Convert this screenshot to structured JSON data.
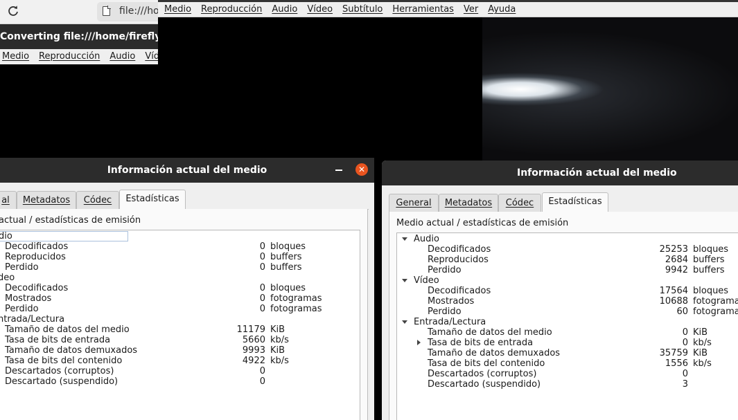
{
  "browser": {
    "url": "file:///ho"
  },
  "converting_window": {
    "title": "Converting file:///home/firefly/M",
    "menu": [
      "Medio",
      "Reproducción",
      "Audio",
      "Víde"
    ]
  },
  "vlc_main": {
    "menu": [
      "Medio",
      "Reproducción",
      "Audio",
      "Vídeo",
      "Subtítulo",
      "Herramientas",
      "Ver",
      "Ayuda"
    ]
  },
  "dialog_left": {
    "title": "Información actual del medio",
    "close_glyph": "✕",
    "tabs": [
      "al",
      "Metadatos",
      "Códec",
      "Estadísticas"
    ],
    "section_label": "actual / estadísticas de emisión",
    "rows": [
      {
        "label": "dio",
        "value": "",
        "unit": "",
        "level": 0
      },
      {
        "label": "Decodificados",
        "value": "0",
        "unit": "bloques",
        "level": 1
      },
      {
        "label": "Reproducidos",
        "value": "0",
        "unit": "buffers",
        "level": 1
      },
      {
        "label": "Perdido",
        "value": "0",
        "unit": "buffers",
        "level": 1
      },
      {
        "label": "deo",
        "value": "",
        "unit": "",
        "level": 0
      },
      {
        "label": "Decodificados",
        "value": "0",
        "unit": "bloques",
        "level": 1
      },
      {
        "label": "Mostrados",
        "value": "0",
        "unit": "fotogramas",
        "level": 1
      },
      {
        "label": "Perdido",
        "value": "0",
        "unit": "fotogramas",
        "level": 1
      },
      {
        "label": "ntrada/Lectura",
        "value": "",
        "unit": "",
        "level": 0
      },
      {
        "label": "Tamaño de datos del medio",
        "value": "11179",
        "unit": "KiB",
        "level": 1
      },
      {
        "label": "Tasa de bits de entrada",
        "value": "5660",
        "unit": "kb/s",
        "level": 1
      },
      {
        "label": "Tamaño de datos demuxados",
        "value": "9993",
        "unit": "KiB",
        "level": 1
      },
      {
        "label": "Tasa de bits del contenido",
        "value": "4922",
        "unit": "kb/s",
        "level": 1
      },
      {
        "label": "Descartados (corruptos)",
        "value": "0",
        "unit": "",
        "level": 1
      },
      {
        "label": "Descartado (suspendido)",
        "value": "0",
        "unit": "",
        "level": 1
      }
    ]
  },
  "dialog_right": {
    "title": "Información actual del medio",
    "tabs": [
      "General",
      "Metadatos",
      "Códec",
      "Estadísticas"
    ],
    "section_label": "Medio actual / estadísticas de emisión",
    "rows": [
      {
        "label": "Audio",
        "value": "",
        "unit": "",
        "level": 0,
        "expander": "down"
      },
      {
        "label": "Decodificados",
        "value": "25253",
        "unit": "bloques",
        "level": 1
      },
      {
        "label": "Reproducidos",
        "value": "2684",
        "unit": "buffers",
        "level": 1
      },
      {
        "label": "Perdido",
        "value": "9942",
        "unit": "buffers",
        "level": 1
      },
      {
        "label": "Vídeo",
        "value": "",
        "unit": "",
        "level": 0,
        "expander": "down"
      },
      {
        "label": "Decodificados",
        "value": "17564",
        "unit": "bloques",
        "level": 1
      },
      {
        "label": "Mostrados",
        "value": "10688",
        "unit": "fotogramas",
        "level": 1
      },
      {
        "label": "Perdido",
        "value": "60",
        "unit": "fotogramas",
        "level": 1
      },
      {
        "label": "Entrada/Lectura",
        "value": "",
        "unit": "",
        "level": 0,
        "expander": "down"
      },
      {
        "label": "Tamaño de datos del medio",
        "value": "0",
        "unit": "KiB",
        "level": 1
      },
      {
        "label": "Tasa de bits de entrada",
        "value": "0",
        "unit": "kb/s",
        "level": 1,
        "expander": "right"
      },
      {
        "label": "Tamaño de datos demuxados",
        "value": "35759",
        "unit": "KiB",
        "level": 1
      },
      {
        "label": "Tasa de bits del contenido",
        "value": "1556",
        "unit": "kb/s",
        "level": 1
      },
      {
        "label": "Descartados (corruptos)",
        "value": "0",
        "unit": "",
        "level": 1
      },
      {
        "label": "Descartado (suspendido)",
        "value": "3",
        "unit": "",
        "level": 1
      }
    ]
  }
}
